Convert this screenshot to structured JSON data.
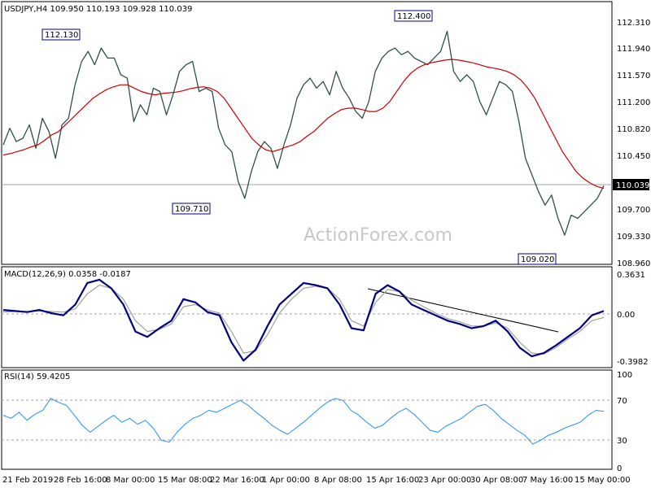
{
  "chart_data": {
    "type": "line",
    "title": "USDJPY,H4  109.950 110.193 109.928 110.039",
    "watermark": "ActionForex.com",
    "current_price_label": "110.039",
    "price_axis_ticks": [
      "112.310",
      "111.940",
      "111.570",
      "111.200",
      "110.820",
      "110.450",
      "109.700",
      "109.330",
      "108.960"
    ],
    "time_axis_ticks": [
      "21 Feb 2019",
      "28 Feb 16:00",
      "8 Mar 00:00",
      "15 Mar 08:00",
      "22 Mar 16:00",
      "1 Apr 00:00",
      "8 Apr 08:00",
      "15 Apr 16:00",
      "23 Apr 00:00",
      "30 Apr 08:00",
      "7 May 16:00",
      "15 May 00:00"
    ],
    "annotations": [
      {
        "label": "112.130",
        "value": 112.13
      },
      {
        "label": "109.710",
        "value": 109.71
      },
      {
        "label": "112.400",
        "value": 112.4
      },
      {
        "label": "109.020",
        "value": 109.02
      }
    ],
    "price_ylim": [
      108.9,
      112.6
    ],
    "price_series": [
      {
        "name": "price",
        "values": [
          110.65,
          110.9,
          110.7,
          110.75,
          110.95,
          110.6,
          111.05,
          110.85,
          110.45,
          110.95,
          111.05,
          111.55,
          111.9,
          112.05,
          111.85,
          112.1,
          111.95,
          111.95,
          111.7,
          111.65,
          111.0,
          111.25,
          111.1,
          111.5,
          111.45,
          111.1,
          111.4,
          111.75,
          111.85,
          111.9,
          111.45,
          111.5,
          111.45,
          110.9,
          110.65,
          110.55,
          110.1,
          109.85,
          110.25,
          110.55,
          110.7,
          110.6,
          110.3,
          110.65,
          110.95,
          111.35,
          111.55,
          111.65,
          111.5,
          111.6,
          111.4,
          111.75,
          111.5,
          111.35,
          111.15,
          111.05,
          111.3,
          111.75,
          111.95,
          112.05,
          112.1,
          112.0,
          112.05,
          111.95,
          111.9,
          111.85,
          111.95,
          112.05,
          112.35,
          111.75,
          111.6,
          111.7,
          111.6,
          111.3,
          111.1,
          111.35,
          111.6,
          111.55,
          111.45,
          111.0,
          110.45,
          110.2,
          109.95,
          109.75,
          109.9,
          109.55,
          109.3,
          109.6,
          109.55,
          109.65,
          109.75,
          109.85,
          110.04
        ]
      },
      {
        "name": "ma",
        "values": [
          110.5,
          110.52,
          110.55,
          110.58,
          110.62,
          110.65,
          110.72,
          110.8,
          110.85,
          110.95,
          111.05,
          111.15,
          111.25,
          111.35,
          111.42,
          111.48,
          111.52,
          111.55,
          111.55,
          111.5,
          111.45,
          111.42,
          111.4,
          111.42,
          111.43,
          111.44,
          111.46,
          111.49,
          111.51,
          111.52,
          111.5,
          111.45,
          111.35,
          111.2,
          111.05,
          110.9,
          110.75,
          110.65,
          110.58,
          110.55,
          110.58,
          110.62,
          110.65,
          110.7,
          110.78,
          110.85,
          110.95,
          111.05,
          111.12,
          111.18,
          111.2,
          111.2,
          111.18,
          111.15,
          111.15,
          111.2,
          111.3,
          111.45,
          111.6,
          111.72,
          111.8,
          111.85,
          111.88,
          111.9,
          111.92,
          111.93,
          111.92,
          111.9,
          111.88,
          111.85,
          111.82,
          111.8,
          111.78,
          111.75,
          111.7,
          111.62,
          111.5,
          111.35,
          111.15,
          110.95,
          110.75,
          110.55,
          110.4,
          110.25,
          110.15,
          110.08,
          110.03,
          110.0
        ]
      }
    ],
    "macd_label": "MACD(12,26,9) 0.0358 -0.0187",
    "macd_axis_ticks": [
      "0.3631",
      "0.00",
      "-0.3982"
    ],
    "macd_ylim": [
      -0.47,
      0.42
    ],
    "macd_series": [
      {
        "name": "macd",
        "values": [
          0.05,
          0.04,
          0.03,
          0.05,
          0.02,
          0.0,
          0.1,
          0.3,
          0.33,
          0.25,
          0.1,
          -0.15,
          -0.2,
          -0.12,
          -0.05,
          0.15,
          0.12,
          0.03,
          0.0,
          -0.25,
          -0.42,
          -0.32,
          -0.1,
          0.1,
          0.2,
          0.3,
          0.28,
          0.25,
          0.1,
          -0.12,
          -0.14,
          0.2,
          0.28,
          0.22,
          0.1,
          0.05,
          0.0,
          -0.05,
          -0.08,
          -0.12,
          -0.1,
          -0.05,
          -0.15,
          -0.3,
          -0.38,
          -0.35,
          -0.28,
          -0.2,
          -0.12,
          0.0,
          0.04
        ]
      },
      {
        "name": "signal",
        "values": [
          0.03,
          0.035,
          0.035,
          0.04,
          0.035,
          0.03,
          0.06,
          0.2,
          0.28,
          0.25,
          0.15,
          -0.05,
          -0.15,
          -0.13,
          -0.08,
          0.08,
          0.1,
          0.05,
          0.02,
          -0.15,
          -0.35,
          -0.33,
          -0.18,
          0.02,
          0.15,
          0.25,
          0.27,
          0.25,
          0.15,
          -0.05,
          -0.1,
          0.12,
          0.24,
          0.22,
          0.14,
          0.08,
          0.02,
          -0.03,
          -0.06,
          -0.1,
          -0.1,
          -0.07,
          -0.12,
          -0.25,
          -0.35,
          -0.36,
          -0.3,
          -0.22,
          -0.15,
          -0.05,
          -0.02
        ]
      }
    ],
    "rsi_label": "RSI(14) 59.4205",
    "rsi_axis_ticks": [
      "100",
      "70",
      "30",
      "0"
    ],
    "rsi_ylim": [
      0,
      100
    ],
    "rsi_levels": [
      70,
      30
    ],
    "rsi_series": [
      {
        "name": "rsi",
        "values": [
          55,
          52,
          58,
          50,
          56,
          60,
          72,
          68,
          65,
          55,
          45,
          38,
          44,
          50,
          55,
          48,
          52,
          46,
          50,
          42,
          30,
          28,
          38,
          46,
          52,
          55,
          60,
          58,
          62,
          66,
          70,
          65,
          58,
          52,
          45,
          40,
          36,
          42,
          48,
          55,
          62,
          68,
          72,
          70,
          60,
          55,
          48,
          42,
          45,
          52,
          58,
          62,
          56,
          48,
          40,
          38,
          44,
          48,
          52,
          58,
          64,
          66,
          60,
          52,
          46,
          40,
          35,
          26,
          30,
          35,
          38,
          42,
          45,
          48,
          55,
          60,
          59
        ]
      }
    ]
  }
}
